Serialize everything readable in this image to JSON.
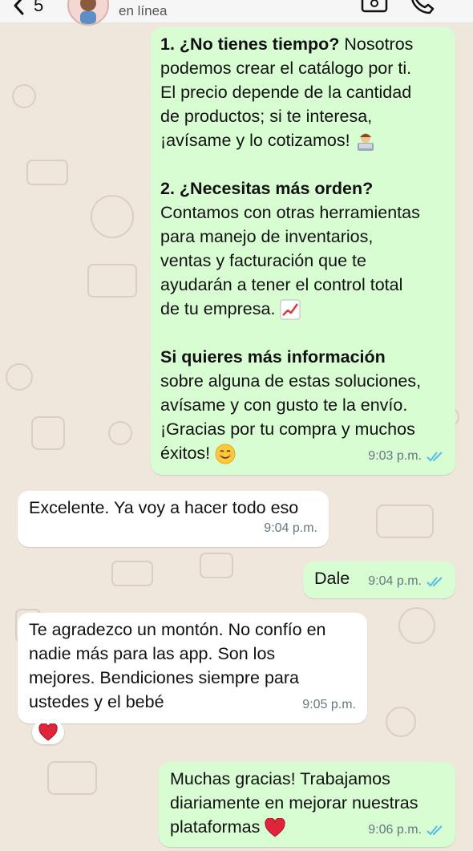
{
  "header": {
    "back_count": "5",
    "status": "en línea"
  },
  "messages": [
    {
      "direction": "out",
      "paragraphs": [
        {
          "bold": "1. ¿No tienes tiempo?",
          "lines": [
            "1. ¿No tienes tiempo? Nosotros",
            "podemos crear el catálogo por ti.",
            "El precio depende de la cantidad",
            "de productos; si te interesa,",
            "¡avísame y lo cotizamos!"
          ]
        },
        {
          "lines": [
            "2. ¿Necesitas más orden?",
            "Contamos con otras herramientas",
            "para manejo de inventarios,",
            "ventas y facturación que te",
            "ayudarán a tener el control total",
            "de tu empresa."
          ]
        },
        {
          "lines": [
            "Si quieres más información",
            "sobre alguna de estas soluciones,",
            "avísame y con gusto te la envío.",
            "¡Gracias por tu compra y muchos",
            "éxitos!"
          ]
        }
      ],
      "time": "9:03 p.m."
    },
    {
      "direction": "in",
      "lines": [
        "Excelente. Ya voy a hacer todo eso"
      ],
      "time": "9:04 p.m."
    },
    {
      "direction": "out",
      "lines": [
        "Dale"
      ],
      "time": "9:04 p.m."
    },
    {
      "direction": "in",
      "lines": [
        "Te agradezco un montón. No confío en",
        "nadie más para las app. Son los",
        "mejores. Bendiciones siempre para",
        "ustedes y el bebé"
      ],
      "time": "9:05 p.m."
    },
    {
      "direction": "out",
      "lines": [
        "Muchas gracias! Trabajamos",
        "diariamente en mejorar nuestras",
        "plataformas"
      ],
      "time": "9:06 p.m."
    }
  ],
  "icons": {
    "read_receipt": "double-check-icon",
    "reaction": "heart-icon",
    "colors": {
      "outgoing": "#d9fdd3",
      "incoming": "#ffffff",
      "read_check": "#53bdeb",
      "heart": "#e0243a"
    }
  }
}
